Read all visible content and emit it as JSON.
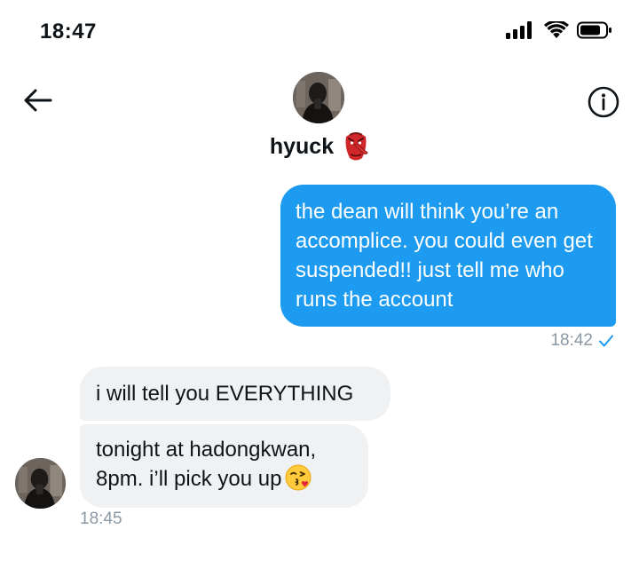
{
  "status_bar": {
    "time": "18:47",
    "icons": [
      "signal-icon",
      "wifi-icon",
      "battery-icon"
    ]
  },
  "header": {
    "back_icon": "back-arrow-icon",
    "info_icon": "info-icon",
    "contact_name": "hyuck",
    "name_emoji": "tengu-mask-emoji"
  },
  "messages": [
    {
      "direction": "sent",
      "text": "the dean will think you’re an accomplice. you could even get suspended!! just tell me who runs the account",
      "time": "18:42",
      "read_icon": "checkmark-icon"
    },
    {
      "direction": "received",
      "text": "i will tell you EVERYTHING"
    },
    {
      "direction": "received",
      "text": "tonight at hadongkwan, 8pm. i’ll pick you up",
      "emoji": "face-blowing-kiss-emoji",
      "time": "18:45"
    }
  ],
  "colors": {
    "sent_bubble": "#1d9bf0",
    "received_bubble": "#eff1f3",
    "timestamp": "#8b98a5"
  }
}
